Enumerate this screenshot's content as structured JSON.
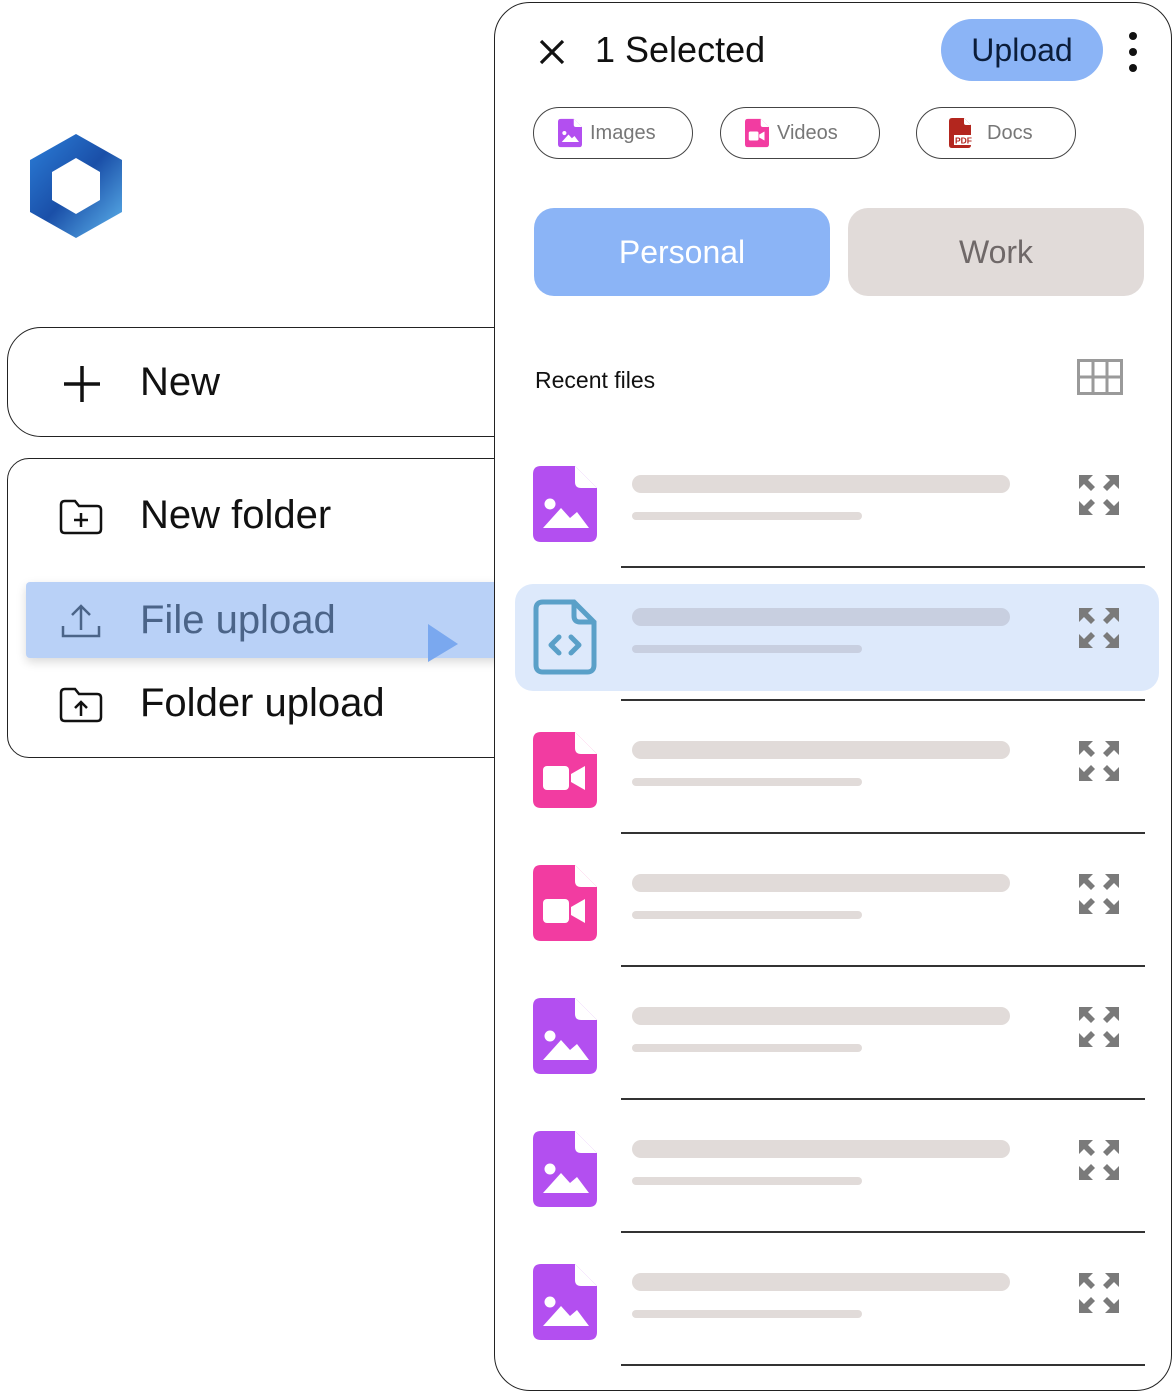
{
  "brand": {
    "logo_icon": "hexagon-logo-icon",
    "colors": {
      "light": "#5fb6ee",
      "dark": "#1a4fa8"
    }
  },
  "new_button": {
    "label": "New",
    "icon": "plus-icon"
  },
  "new_menu": {
    "items": [
      {
        "label": "New folder",
        "icon": "folder-plus-icon"
      },
      {
        "label": "File upload",
        "icon": "upload-icon",
        "highlighted": true
      },
      {
        "label": "Folder upload",
        "icon": "folder-upload-icon"
      }
    ]
  },
  "panel": {
    "title": "1 Selected",
    "close_icon": "close-icon",
    "upload_label": "Upload",
    "more_icon": "more-vertical-icon",
    "filters": [
      {
        "label": "Images",
        "icon": "image-file-icon",
        "color": "#b34ff0"
      },
      {
        "label": "Videos",
        "icon": "video-file-icon",
        "color": "#f23ca1"
      },
      {
        "label": "Docs",
        "icon": "pdf-file-icon",
        "color": "#b3261e"
      }
    ],
    "tabs": [
      {
        "label": "Personal",
        "active": true
      },
      {
        "label": "Work",
        "active": false
      }
    ],
    "recent_label": "Recent files",
    "view_icon": "grid-view-icon",
    "files": [
      {
        "type": "image",
        "icon": "image-file-icon",
        "selected": false
      },
      {
        "type": "code",
        "icon": "code-file-icon",
        "selected": true
      },
      {
        "type": "video",
        "icon": "video-file-icon",
        "selected": false
      },
      {
        "type": "video",
        "icon": "video-file-icon",
        "selected": false
      },
      {
        "type": "image",
        "icon": "image-file-icon",
        "selected": false
      },
      {
        "type": "image",
        "icon": "image-file-icon",
        "selected": false
      },
      {
        "type": "image",
        "icon": "image-file-icon",
        "selected": false
      }
    ]
  },
  "colors": {
    "accent": "#8bb4f6",
    "menu_highlight": "#b9d1f7",
    "row_highlight": "#dde9fb",
    "placeholder": "#e1dbd9",
    "image_icon": "#b34ff0",
    "video_icon": "#f23ca1",
    "code_icon": "#5aa0c8"
  }
}
